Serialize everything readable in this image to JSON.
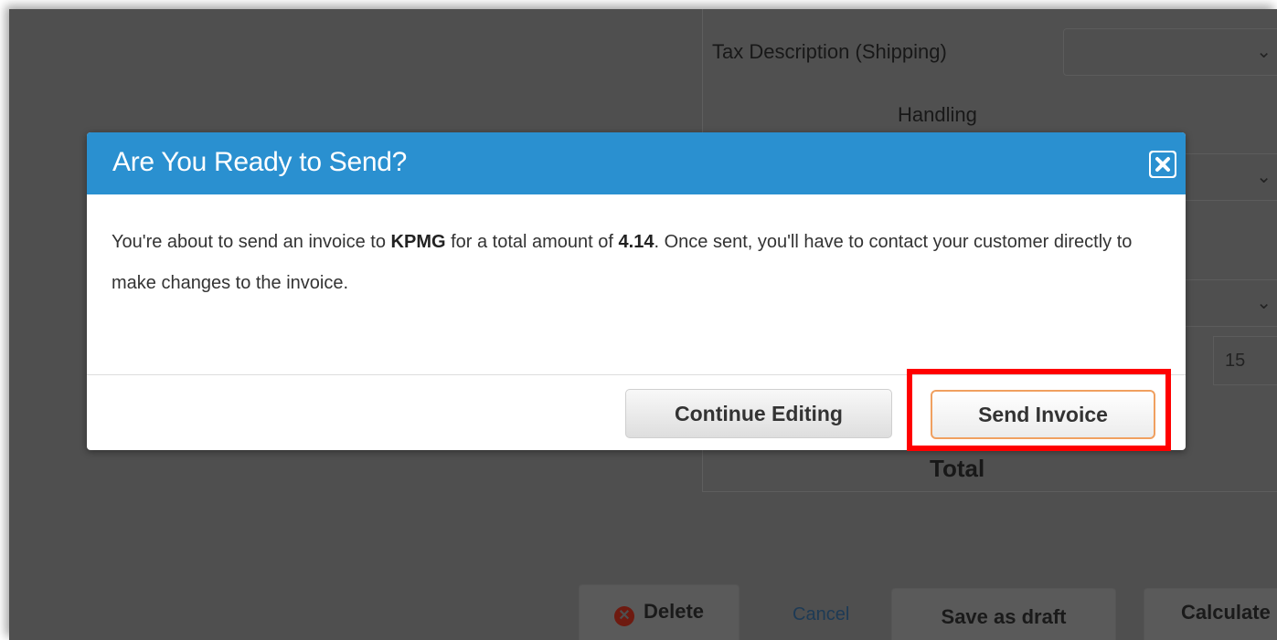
{
  "background": {
    "tax_description_label": "Tax Description (Shipping)",
    "handling_label": "Handling",
    "total_label": "Total",
    "number_input_value": "15",
    "delete_label": "Delete",
    "cancel_label": "Cancel",
    "save_draft_label": "Save as draft",
    "calculate_label": "Calculate"
  },
  "modal": {
    "title": "Are You Ready to Send?",
    "body": {
      "text_before_customer": "You're about to send an invoice to ",
      "customer": "KPMG",
      "text_before_amount": " for a total amount of ",
      "amount": "4.14",
      "text_after_amount": ". Once sent, you'll have to contact your customer directly to make changes to the invoice."
    },
    "continue_label": "Continue Editing",
    "send_label": "Send Invoice"
  },
  "colors": {
    "header_blue": "#2a90d0",
    "highlight_red": "#ff0000",
    "send_border_orange": "#f0a060"
  },
  "icons": [
    "close-icon",
    "chevron-down-icon",
    "delete-icon"
  ]
}
